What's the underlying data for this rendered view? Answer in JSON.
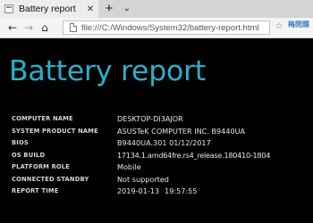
{
  "browser": {
    "tab": {
      "title": "Battery report",
      "close_glyph": "✕"
    },
    "new_tab_glyph": "+",
    "tab_list_glyph": "⌄",
    "nav": {
      "back": "←",
      "forward": "→",
      "home": "⌂"
    },
    "address": {
      "url": "file:///C:/Windows/System32/battery-report.html"
    },
    "watermark": "梅問題"
  },
  "report": {
    "title": "Battery report",
    "rows": [
      {
        "label": "COMPUTER NAME",
        "value": "DESKTOP-DI3AJOR"
      },
      {
        "label": "SYSTEM PRODUCT NAME",
        "value": "ASUSTeK COMPUTER INC. B9440UA"
      },
      {
        "label": "BIOS",
        "value": "B9440UA.301 01/12/2017"
      },
      {
        "label": "OS BUILD",
        "value": "17134.1.amd64fre.rs4_release.180410-1804"
      },
      {
        "label": "PLATFORM ROLE",
        "value": "Mobile"
      },
      {
        "label": "CONNECTED STANDBY",
        "value": "Not supported"
      },
      {
        "label": "REPORT TIME",
        "date": "2019-01-13",
        "time": "19:57:55"
      }
    ]
  },
  "colors": {
    "title": "#2ab0ca",
    "background": "#000000"
  }
}
